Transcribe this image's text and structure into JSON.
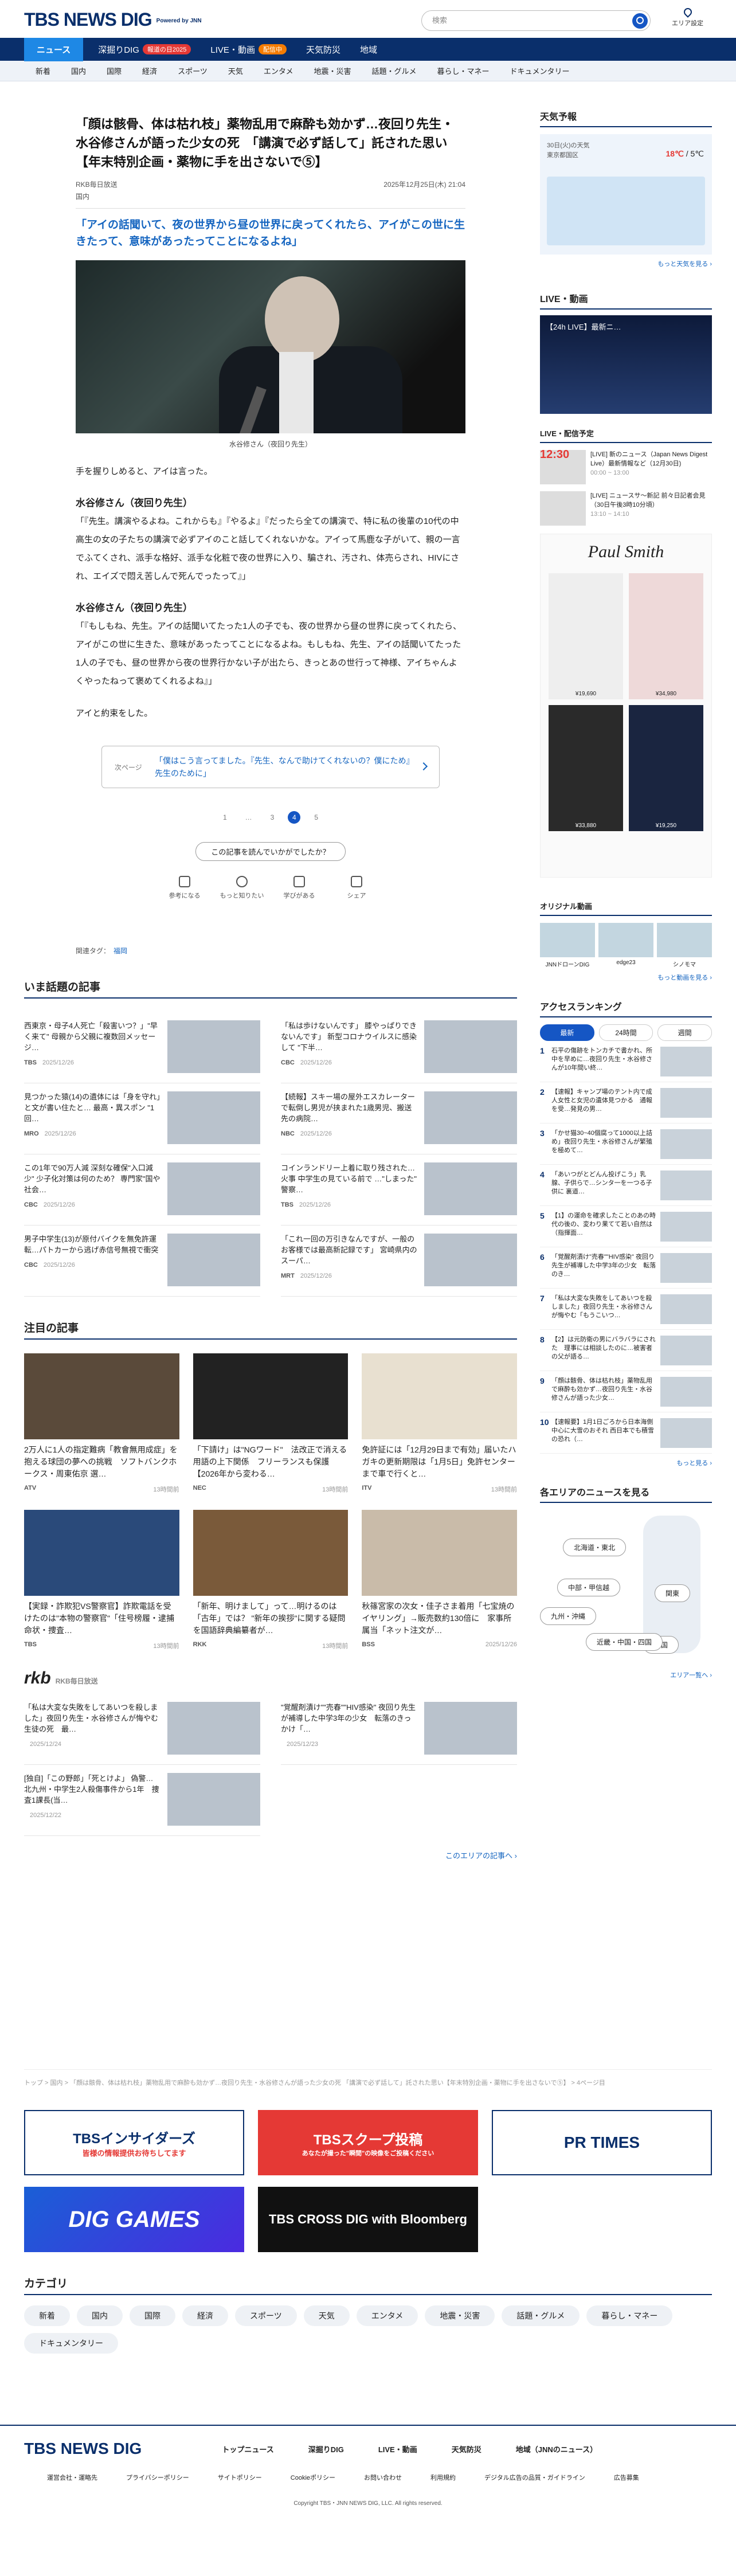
{
  "header": {
    "logo": "TBS NEWS DIG",
    "logo_sub": "Powered by JNN",
    "search_placeholder": "検索",
    "area_label": "エリア設定"
  },
  "nav1": [
    {
      "label": "ニュース",
      "active": true
    },
    {
      "label": "深掘りDIG",
      "badge": "報道の日2025"
    },
    {
      "label": "LIVE・動画",
      "badge": "配信中"
    },
    {
      "label": "天気防災"
    },
    {
      "label": "地域"
    }
  ],
  "nav2": [
    "新着",
    "国内",
    "国際",
    "経済",
    "スポーツ",
    "天気",
    "エンタメ",
    "地震・災害",
    "話題・グルメ",
    "暮らし・マネー",
    "ドキュメンタリー"
  ],
  "article": {
    "title": "「顔は骸骨、体は枯れ枝」薬物乱用で麻酔も効かず…夜回り先生・水谷修さんが語った少女の死　「講演で必ず話して」託された思い【年末特別企画・薬物に手を出さないで⑤】",
    "source": "RKB毎日放送",
    "datetime": "2025年12月25日(木) 21:04",
    "category": "国内",
    "lead": "「アイの話聞いて、夜の世界から昼の世界に戻ってくれたら、アイがこの世に生きたって、意味があったってことになるよね」",
    "caption": "水谷修さん（夜回り先生）",
    "p1": "手を握りしめると、アイは言った。",
    "speaker1": "水谷修さん（夜回り先生）",
    "p2": "「『先生。講演やるよね。これからも』『やるよ』『だったら全ての講演で、特に私の後輩の10代の中高生の女の子たちの講演で必ずアイのこと話してくれないかな。アイって馬鹿な子がいて、親の一言でふてくされ、派手な格好、派手な化粧で夜の世界に入り、騙され、汚され、体売らされ、HIVにされ、エイズで悶え苦しんで死んでったって』」",
    "speaker2": "水谷修さん（夜回り先生）",
    "p3": "「『もしもね、先生。アイの話聞いてたった1人の子でも、夜の世界から昼の世界に戻ってくれたら、アイがこの世に生きた、意味があったってことになるよね。もしもね、先生、アイの話聞いてたった1人の子でも、昼の世界から夜の世界行かない子が出たら、きっとあの世行って神様、アイちゃんよくやったねって褒めてくれるよね』」",
    "p4": "アイと約束をした。",
    "next_label": "次ページ",
    "next_text": "「僕はこう言ってました。『先生、なんで助けてくれないの？僕にため』先生のために」",
    "pages": [
      "1",
      "…",
      "3",
      "4",
      "5"
    ],
    "current_page": 4,
    "question": "この記事を読んでいかがでしたか？",
    "reactions": [
      "参考になる",
      "もっと知りたい",
      "学びがある",
      "シェア"
    ],
    "tags_label": "関連タグ：",
    "tag": "福岡"
  },
  "popular": {
    "heading": "いま話題の記事",
    "items": [
      {
        "title": "西東京・母子4人死亡「殺害いつ？」\"早く来て\" 母親から父親に複数回メッセージ…",
        "source": "TBS",
        "date": "2025/12/26"
      },
      {
        "title": "「私は歩けないんです」 膝やっぱりできないんです」 新型コロナウイルスに感染して \"下半…",
        "source": "CBC",
        "date": "2025/12/26"
      },
      {
        "title": "見つかった猿(14)の遺体には「身を守れ」と文が書い住たと… 最高・異スポン \"1回…",
        "source": "MRO",
        "date": "2025/12/26"
      },
      {
        "title": "【続報】スキー場の屋外エスカレーターで転倒し男児が挟まれた1歳男児、搬送先の病院…",
        "source": "NBC",
        "date": "2025/12/26"
      },
      {
        "title": "この1年で90万人減 深刻な確保\"入口減少\" 少子化対策は何のため？ 専門家\"国や社会…",
        "source": "CBC",
        "date": "2025/12/26"
      },
      {
        "title": "コインランドリー上着に取り残された…火事 中学生の見ている前で …\"しまった\" 警察…",
        "source": "TBS",
        "date": "2025/12/26"
      },
      {
        "title": "男子中学生(13)が原付バイクを無免許運転…パトカーから逃げ赤信号無視で衝突",
        "source": "CBC",
        "date": "2025/12/26"
      },
      {
        "title": "「これ一回の万引きなんですが、一般のお客様では最高新記録です」 宮崎県内のスーパ…",
        "source": "MRT",
        "date": "2025/12/26"
      }
    ]
  },
  "featured": {
    "heading": "注目の記事",
    "items": [
      {
        "title": "2万人に1人の指定難病「教會無用成症」を抱える球団の夢への挑戦　ソフトバンクホークス・周東佑京 選…",
        "source": "ATV",
        "date": "13時間前"
      },
      {
        "title": "「下請け」は\"NGワード\"　法改正で消える用語の上下関係　フリーランスも保護【2026年から変わる…",
        "source": "NEC",
        "date": "13時間前"
      },
      {
        "title": "免許証には「12月29日まで有効」届いたハガキの更新期限は「1月5日」免許センターまで車で行くと…",
        "source": "ITV",
        "date": "13時間前"
      },
      {
        "title": "【実録・詐欺犯VS警察官】詐欺電話を受けたのは\"本物の警察官\"「住号榜履・逮捕命状・捜査…",
        "source": "TBS",
        "date": "13時間前"
      },
      {
        "title": "「新年、明けまして」って…明けるのは「古年」では？ \"新年の挨拶\"に関する疑問を国語辞典編纂者が…",
        "source": "RKK",
        "date": "13時間前"
      },
      {
        "title": "秋篠宮家の次女・佳子さま着用「七宝焼のイヤリング」→販売数約130倍に　家事所属当「ネット注文が…",
        "source": "BSS",
        "date": "2025/12/26"
      }
    ]
  },
  "rkb": {
    "logo": "rkb",
    "label": "RKB毎日放送",
    "items": [
      {
        "title": "「私は大変な失敗をしてあいつを殺しました」夜回り先生・水谷修さんが悔やむ生徒の死　最…",
        "date": "2025/12/24"
      },
      {
        "title": "\"覚醒剤漬け\"\"売春\"\"HIV感染\" 夜回り先生が補導した中学3年の少女　転落のきっかけ「…",
        "date": "2025/12/23"
      },
      {
        "title": "[独自]「この野郎」「死とけよ」 偽警… 北九州・中学生2人殺傷事件から1年　捜査1課長(当…",
        "date": "2025/12/22"
      }
    ],
    "more": "このエリアの記事へ ›"
  },
  "breadcrumb": "トップ > 国内 > 「顔は骸骨、体は枯れ枝」薬物乱用で麻酔も効かず…夜回り先生・水谷修さんが語った少女の死 「講演で必ず話して」託された思い【年末特別企画・薬物に手を出さないで⑤】 > 4ページ目",
  "banners": [
    "TBSインサイダーズ",
    "TBSスクープ投稿",
    "PR TIMES",
    "DIG GAMES",
    "TBS CROSS DIG with Bloomberg"
  ],
  "banner_sub": {
    "insiders": "皆様の情報提供お待ちしてます",
    "scoop": "あなたが撮った\"瞬間\"の映像をご投稿ください"
  },
  "categories": {
    "heading": "カテゴリ",
    "items": [
      "新着",
      "国内",
      "国際",
      "経済",
      "スポーツ",
      "天気",
      "エンタメ",
      "地震・災害",
      "話題・グルメ",
      "暮らし・マネー",
      "ドキュメンタリー"
    ]
  },
  "side": {
    "weather_heading": "天気予報",
    "weather_date": "30日(火)の天気",
    "weather_area": "東京都国区",
    "weather_hi": "18℃",
    "weather_lo": "5℃",
    "weather_more": "もっと天気を見る ›",
    "live_heading": "LIVE・動画",
    "live_title": "【24h LIVE】最新ニ…",
    "schedule_heading": "LIVE・配信予定",
    "schedule": [
      {
        "time": "12:30",
        "title": "[LIVE] 新のニュース（Japan News Digest Live）最新情報など（12月30日)",
        "at": "00:00 ~ 13:00"
      },
      {
        "title": "[LIVE] ニュースサ～新記 前々日記者会見（30日午後3時10分頃）",
        "at": "13:10 ~ 14:10"
      }
    ],
    "ad_brand": "Paul Smith",
    "ad_prices": [
      "¥19,690",
      "¥34,980",
      "¥33,880",
      "¥19,250"
    ],
    "original_heading": "オリジナル動画",
    "originals": [
      "JNNドローンDIG",
      "edge23",
      "シノモマ"
    ],
    "original_more": "もっと動画を見る ›",
    "ranking_heading": "アクセスランキング",
    "ranking_tabs": [
      "最新",
      "24時間",
      "週間"
    ],
    "ranking": [
      "石平の傷跡をトンカチで書かれ、所中を早めに…夜回り先生・水谷修さんが10年間い終…",
      "【速報】キャンプ場のテント内で成人女性と女児の遺体見つかる　通報を受…発見の男…",
      "「かせ猫30~40個腐って1000以上詰め」夜回り先生・水谷修さんが繁殖を極めて…",
      "「あいつがとどんん投げこう」乳腺、子供らで…シンタ一を一つる子供に 裏道…",
      "【1】の運命を確求したことのあの時代の後の、変わり果てて若い自然は（指揮面…",
      "「覚醒剤漬け\"売春\"\"HIV感染\" 夜回り先生が補導した中学3年の少女　転落のき…",
      "「私は大変な失敗をしてあいつを殺しました」夜回り先生・水谷修さんが悔やむ「もうこいつ…",
      "【2】は元防衛の男にバラバラにされた　理事には相談したのに…被害者の父が語る…",
      "「顔は骸骨、体は枯れ枝」薬物乱用で麻酔も効かず…夜回り先生・水谷修さんが語った少女…",
      "【速報要】1月1日ごろから日本海側中心に大雪のおそれ 西日本でも積雪の恐れ（…"
    ],
    "ranking_more": "もっと見る ›",
    "areas_heading": "各エリアのニュースを見る",
    "areas": [
      "北海道・東北",
      "関東",
      "中部・甲信越",
      "九州・沖縄",
      "四国",
      "近畿・中国・四国"
    ],
    "areas_more": "エリア一覧へ ›"
  },
  "footer": {
    "logo": "TBS NEWS DIG",
    "links": [
      "トップニュース",
      "深掘りDIG",
      "LIVE・動画",
      "天気防災",
      "地域（JNNのニュース）"
    ],
    "sub": [
      "運営会社・運略先",
      "プライバシーポリシー",
      "サイトポリシー",
      "Cookieポリシー",
      "お問い合わせ",
      "利用規約",
      "デジタル広告の品質・ガイドライン",
      "広告募集"
    ],
    "copyright": "Copyright TBS・JNN NEWS DIG, LLC. All rights reserved."
  }
}
